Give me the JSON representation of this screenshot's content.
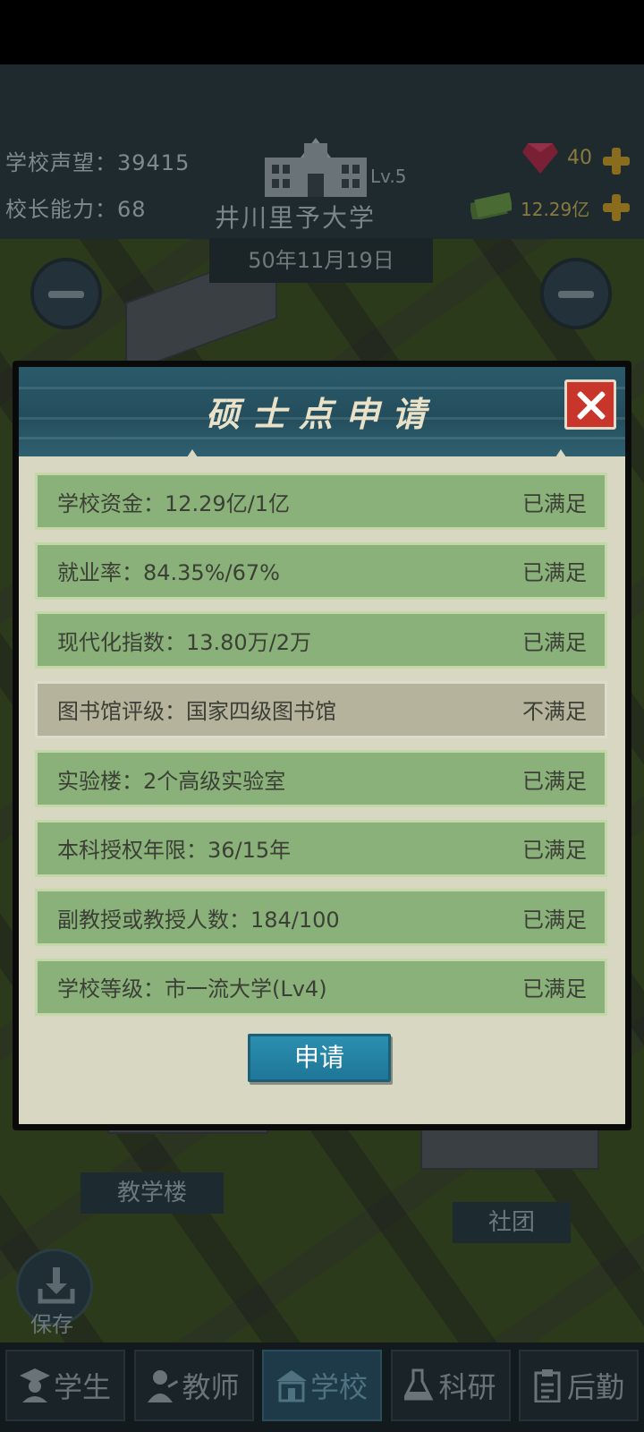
{
  "hud": {
    "reputation": "学校声望：39415",
    "principal_ability": "校长能力：68",
    "school_level": "Lv.5",
    "school_name": "井川里予大学",
    "date": "50年11月19日",
    "gems": "40",
    "money": "12.29亿"
  },
  "scene": {
    "building_label_teaching": "教学楼",
    "building_label_club": "社团",
    "save_label": "保存"
  },
  "dialog": {
    "title": "硕士点申请",
    "requirements": [
      {
        "text": "学校资金：12.29亿/1亿",
        "status": "已满足",
        "met": true
      },
      {
        "text": "就业率：84.35%/67%",
        "status": "已满足",
        "met": true
      },
      {
        "text": "现代化指数：13.80万/2万",
        "status": "已满足",
        "met": true
      },
      {
        "text": "图书馆评级：国家四级图书馆",
        "status": "不满足",
        "met": false
      },
      {
        "text": "实验楼：2个高级实验室",
        "status": "已满足",
        "met": true
      },
      {
        "text": "本科授权年限：36/15年",
        "status": "已满足",
        "met": true
      },
      {
        "text": "副教授或教授人数：184/100",
        "status": "已满足",
        "met": true
      },
      {
        "text": "学校等级：市一流大学(Lv4)",
        "status": "已满足",
        "met": true
      }
    ],
    "apply_label": "申请"
  },
  "nav": {
    "tabs": [
      {
        "label": "学生",
        "icon": "student-icon",
        "active": false
      },
      {
        "label": "教师",
        "icon": "teacher-icon",
        "active": false
      },
      {
        "label": "学校",
        "icon": "school-icon",
        "active": true
      },
      {
        "label": "科研",
        "icon": "research-icon",
        "active": false
      },
      {
        "label": "后勤",
        "icon": "logistics-icon",
        "active": false
      }
    ]
  },
  "colors": {
    "met_row": "#8ab17a",
    "unmet_row": "#b5b39c",
    "header": "#2a5b6b",
    "close": "#c8352a",
    "apply_button": "#2a8fb0"
  }
}
